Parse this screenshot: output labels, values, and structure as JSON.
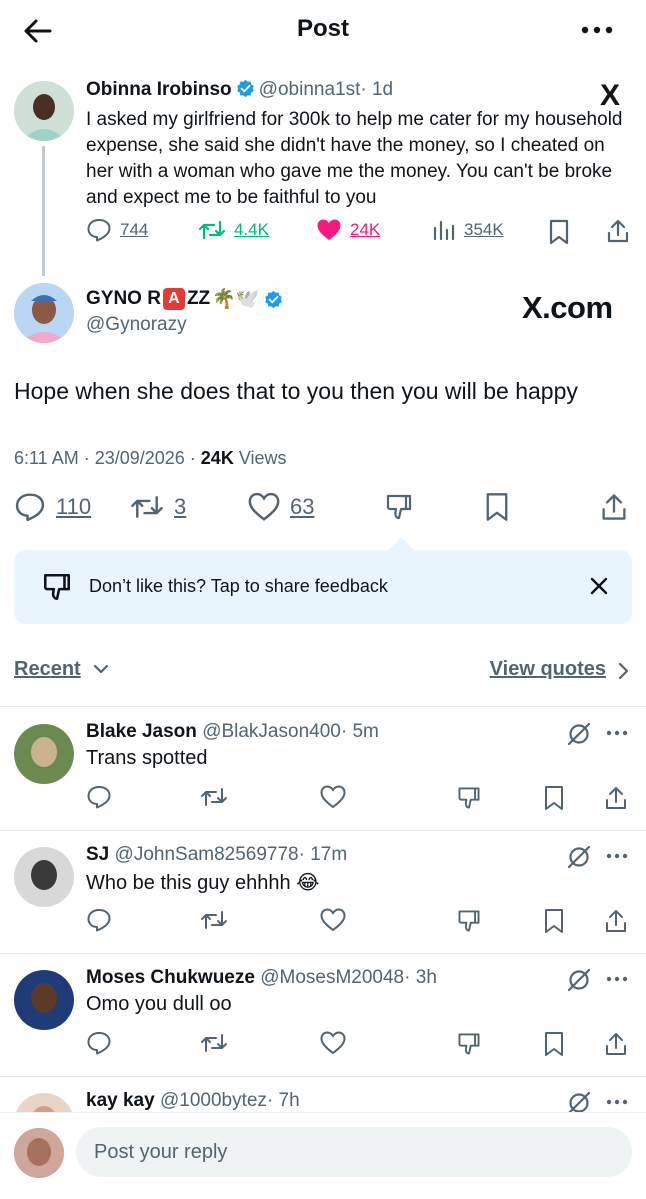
{
  "header": {
    "title": "Post"
  },
  "parent_post": {
    "name": "Obinna Irobinso",
    "handle": "@obinna1st",
    "time": "· 1d",
    "text": "I asked my girlfriend for 300k to help me cater for my household expense, she said she didn't have the money, so I cheated on her with a woman who gave me the money. You can't be broke and expect me to be faithful to you",
    "replies": "744",
    "reposts": "4.4K",
    "likes": "24K",
    "views": "354K",
    "x_logo": "X"
  },
  "main_post": {
    "name_prefix": "GYNO R",
    "name_boxed": "A",
    "name_suffix": "ZZ",
    "name_emoji": "🌴🕊️",
    "handle": "@Gynorazy",
    "watermark": "X.com",
    "text": "Hope when she does that to you then you will be happy",
    "timestamp": "6:11 AM · 23/09/2026 · ",
    "views_count": "24K",
    "views_label": " Views",
    "replies": "110",
    "reposts": "3",
    "likes": "63"
  },
  "feedback": {
    "text": "Don’t like this? Tap to share feedback"
  },
  "sort": {
    "recent_label": "Recent",
    "quotes_label": "View quotes"
  },
  "replies": [
    {
      "name": "Blake Jason",
      "handle": "@BlakJason400",
      "time": "· 5m",
      "text": "Trans spotted"
    },
    {
      "name": "SJ",
      "handle": "@JohnSam82569778",
      "time": "· 17m",
      "text": "Who be this guy ehhhh 😂"
    },
    {
      "name": "Moses Chukwueze",
      "handle": "@MosesM20048",
      "time": "· 3h",
      "text": "Omo you dull oo"
    },
    {
      "name": "kay kay",
      "handle": "@1000bytez",
      "time": "· 7h",
      "text": ""
    }
  ],
  "composer": {
    "placeholder": "Post your reply"
  },
  "colors": {
    "accent": "#1d9bf0",
    "like": "#f91880",
    "repost": "#00ba7c",
    "muted": "#536471"
  }
}
